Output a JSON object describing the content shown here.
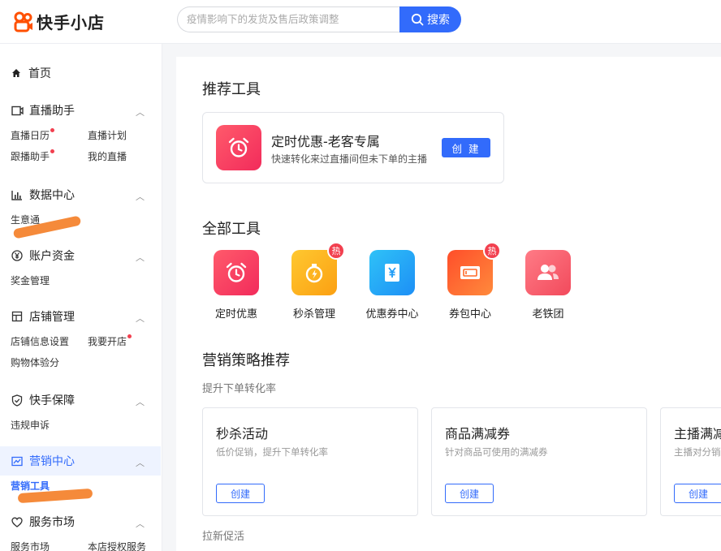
{
  "header": {
    "logo_text": "快手小店",
    "search_placeholder": "疫情影响下的发货及售后政策调整",
    "search_button": "搜索"
  },
  "sidebar": {
    "home": "首页",
    "groups": [
      {
        "title": "直播助手",
        "icon": "live-monitor-icon",
        "items": [
          "直播日历",
          "直播计划",
          "跟播助手",
          "我的直播"
        ]
      },
      {
        "title": "数据中心",
        "icon": "bar-chart-icon",
        "items": [
          "生意通"
        ]
      },
      {
        "title": "账户资金",
        "icon": "yen-icon",
        "items": [
          "奖金管理"
        ]
      },
      {
        "title": "店铺管理",
        "icon": "store-icon",
        "items": [
          "店铺信息设置",
          "我要开店",
          "购物体验分"
        ]
      },
      {
        "title": "快手保障",
        "icon": "shield-icon",
        "items": [
          "违规申诉"
        ]
      },
      {
        "title": "营销中心",
        "icon": "trend-chart-icon",
        "items": [
          "营销工具"
        ]
      },
      {
        "title": "服务市场",
        "icon": "heart-icon",
        "items": [
          "服务市场",
          "本店授权服务"
        ]
      }
    ]
  },
  "main": {
    "recommend_title": "推荐工具",
    "recommend_card": {
      "title": "定时优惠-老客专属",
      "desc": "快速转化来过直播间但未下单的主播",
      "button": "创 建",
      "icon": "alarm-clock-icon"
    },
    "all_tools_title": "全部工具",
    "hot_badge": "热",
    "tools": [
      {
        "label": "定时优惠",
        "icon": "alarm-clock-icon",
        "color": "#f22b5b"
      },
      {
        "label": "秒杀管理",
        "icon": "stopwatch-icon",
        "color": "#fbb21a"
      },
      {
        "label": "优惠券中心",
        "icon": "coupon-yen-icon",
        "color": "#1d9bf6"
      },
      {
        "label": "券包中心",
        "icon": "ticket-pack-icon",
        "color": "#ff6a2a"
      },
      {
        "label": "老铁团",
        "icon": "group-users-icon",
        "color": "#f25a6b"
      }
    ],
    "strategy_title": "营销策略推荐",
    "strategy_subtitle": "提升下单转化率",
    "strategy_cards": [
      {
        "title": "秒杀活动",
        "desc": "低价促销，提升下单转化率",
        "button": "创建"
      },
      {
        "title": "商品满减券",
        "desc": "针对商品可使用的满减券",
        "button": "创建"
      },
      {
        "title": "主播满减",
        "desc": "主播对分销",
        "button": "创建"
      }
    ],
    "next_section": "拉新促活"
  },
  "colors": {
    "brand": "#326bfb",
    "logo": "#ff5000",
    "hot": "#f2404f",
    "redaction": "#f58a3a"
  }
}
